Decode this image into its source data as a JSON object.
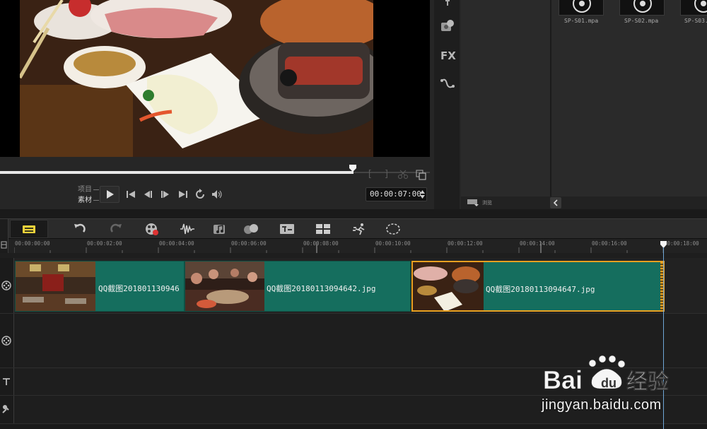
{
  "preview": {
    "mode_project": "项目",
    "mode_clip": "素材",
    "timecode": "00:00:07:00"
  },
  "library": {
    "fx_label": "FX",
    "thumbnails": [
      {
        "label": "SP-S01.mpa"
      },
      {
        "label": "SP-S02.mpa"
      },
      {
        "label": "SP-S03."
      }
    ],
    "browse_label": "浏览"
  },
  "ruler": {
    "ticks": [
      "00:00:00:00",
      "00:00:02:00",
      "00:00:04:00",
      "00:00:06:00",
      "00:00:08:00",
      "00:00:10:00",
      "00:00:12:00",
      "00:00:14:00",
      "00:00:16:00",
      "00:00:18:00"
    ]
  },
  "timeline": {
    "clips": [
      {
        "name": "QQ截图201801130946"
      },
      {
        "name": "QQ截图20180113094642.jpg"
      },
      {
        "name": "QQ截图20180113094647.jpg"
      }
    ]
  },
  "watermark": {
    "logo_text": "Bai 经验",
    "url": "jingyan.baidu.com"
  },
  "colors": {
    "clip_fill": "#156e5e",
    "selected_clip_border": "#e8a020",
    "playhead": "#6fa6d6"
  }
}
